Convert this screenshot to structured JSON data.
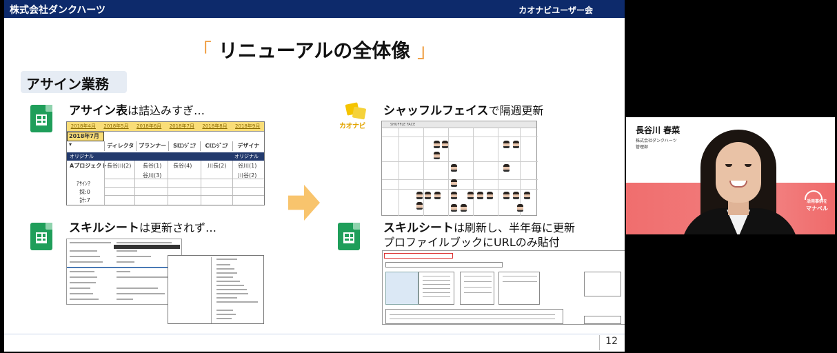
{
  "slide": {
    "company": "株式会社ダンクハーツ",
    "event": "カオナビユーザー会",
    "title": "リニューアルの全体像",
    "title_open_bracket": "「",
    "title_close_bracket": "」",
    "section_tag": "アサイン業務",
    "page_number": "12",
    "accent_color": "#f0a24a",
    "header_color": "#0d2a6b"
  },
  "before": {
    "assign": {
      "icon": "google-sheets-icon",
      "caption_bold": "アサイン表",
      "caption_rest": "は詰込みすぎ…",
      "months": [
        "2018年4月",
        "2018年5月",
        "2018年6月",
        "2018年7月",
        "2018年8月",
        "2018年9月"
      ],
      "selected_month": "2018年7月",
      "roles": [
        "ディレクタ",
        "プランナー",
        "SIｴﾝｼﾞﾆｱ",
        "CIｴﾝｼﾞﾆｱ",
        "デザイナ"
      ],
      "original_label": "オリジナル",
      "project": "Aプロジェクト",
      "assignees_row1": [
        "長谷川(2)",
        "長谷(1)",
        "長谷(4)",
        "川長(2)",
        "谷川(1)"
      ],
      "assignees_row2": [
        "谷川(3)",
        "川谷(2)"
      ],
      "row_labels": [
        "ｱｻｲﾝ?",
        "採:0",
        "計:7"
      ]
    },
    "skill": {
      "icon": "google-sheets-icon",
      "caption_bold": "スキルシート",
      "caption_rest": "は更新されず…"
    }
  },
  "after": {
    "shuffle": {
      "icon": "kaonavi-logo",
      "logo_text": "カオナビ",
      "caption_bold": "シャッフルフェイス",
      "caption_rest": "で隔週更新",
      "app_header": "SHUFFLE FACE"
    },
    "skill": {
      "icon": "google-sheets-icon",
      "caption_bold": "スキルシート",
      "caption_rest": "は刷新し、半年毎に更新",
      "caption_line2": "プロファイルブックにURLのみ貼付"
    }
  },
  "video": {
    "speaker_name": "長谷川 春菜",
    "speaker_company": "株式会社ダンクハーツ",
    "speaker_dept": "管理部",
    "brand_line1": "活用事例を",
    "brand_line2": "マナベル",
    "band_color": "#f06e6e"
  }
}
